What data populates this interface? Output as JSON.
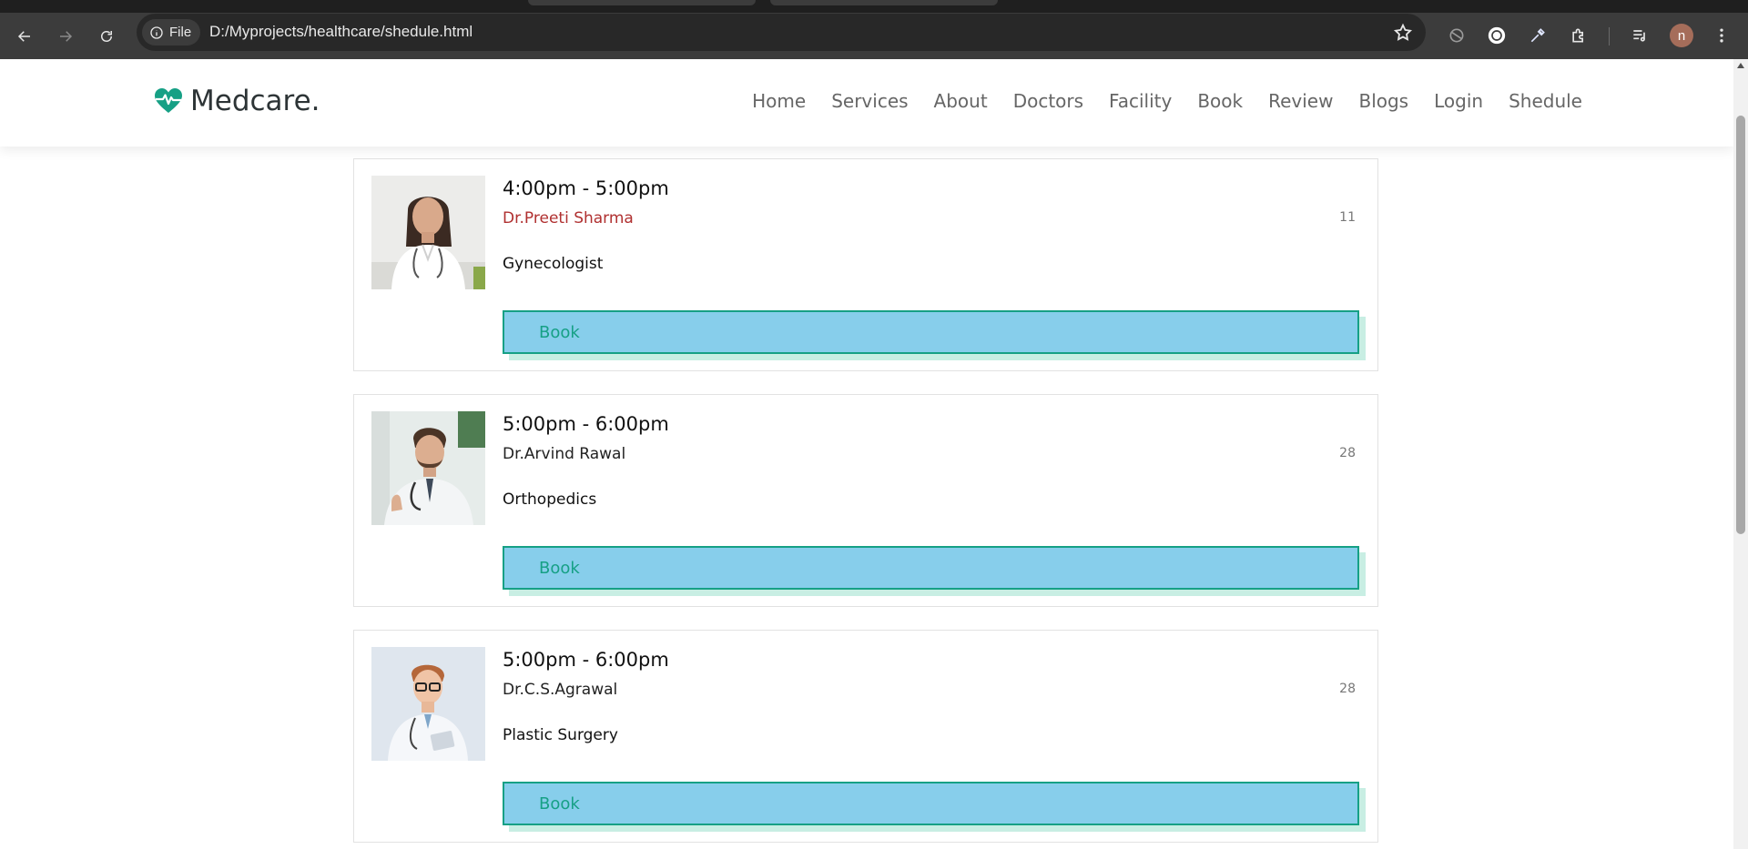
{
  "browser": {
    "file_chip_label": "File",
    "url": "D:/Myprojects/healthcare/shedule.html",
    "profile_initial": "n"
  },
  "site": {
    "logo_text": "Medcare.",
    "brand_color": "#16a085",
    "nav": [
      "Home",
      "Services",
      "About",
      "Doctors",
      "Facility",
      "Book",
      "Review",
      "Blogs",
      "Login",
      "Shedule"
    ]
  },
  "schedule": [
    {
      "time": "4:00pm - 5:00pm",
      "doctor": "Dr.Preeti Sharma",
      "specialty": "Gynecologist",
      "count": "11",
      "button": "Book"
    },
    {
      "time": "5:00pm - 6:00pm",
      "doctor": "Dr.Arvind Rawal",
      "specialty": "Orthopedics",
      "count": "28",
      "button": "Book"
    },
    {
      "time": "5:00pm - 6:00pm",
      "doctor": "Dr.C.S.Agrawal",
      "specialty": "Plastic Surgery",
      "count": "28",
      "button": "Book"
    }
  ],
  "colors": {
    "button_bg": "#87ceeb",
    "button_border": "#16a085",
    "button_shadow": "#c8eee3",
    "highlight_name": "#b03030"
  }
}
